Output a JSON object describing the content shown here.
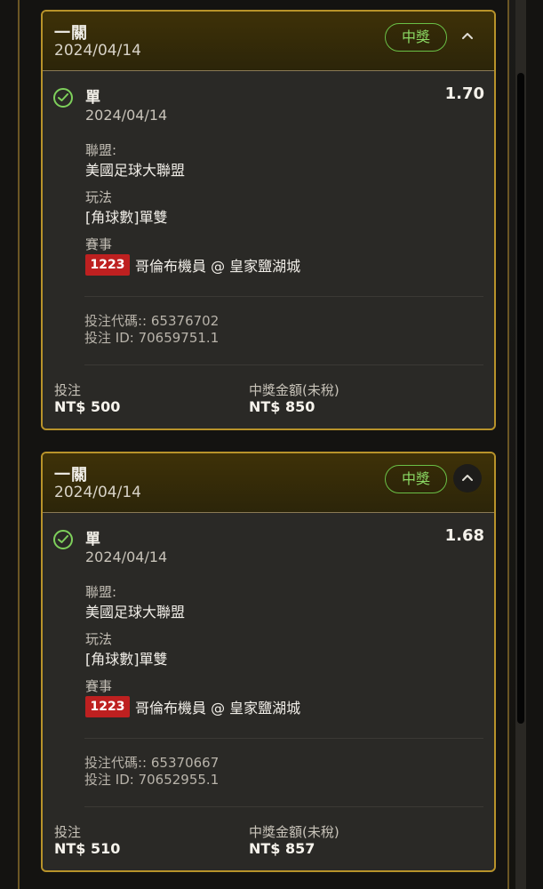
{
  "bets": [
    {
      "title": "一關",
      "header_date": "2024/04/14",
      "status": "中獎",
      "toggle_icon": "chevron-up-icon",
      "selection": {
        "type": "單",
        "date": "2024/04/14",
        "odds": "1.70",
        "league_label": "聯盟:",
        "league": "美國足球大聯盟",
        "play_label": "玩法",
        "play": "[角球數]單雙",
        "match_label": "賽事",
        "event_code": "1223",
        "match": "哥倫布機員 @ 皇家鹽湖城",
        "bet_code_label": "投注代碼::",
        "bet_code": "65376702",
        "bet_id_label": "投注 ID:",
        "bet_id": "70659751.1"
      },
      "stake_label": "投注",
      "stake": "NT$ 500",
      "payout_label": "中獎金額(未稅)",
      "payout": "NT$ 850"
    },
    {
      "title": "一關",
      "header_date": "2024/04/14",
      "status": "中獎",
      "toggle_icon": "chevron-up-icon",
      "selection": {
        "type": "單",
        "date": "2024/04/14",
        "odds": "1.68",
        "league_label": "聯盟:",
        "league": "美國足球大聯盟",
        "play_label": "玩法",
        "play": "[角球數]單雙",
        "match_label": "賽事",
        "event_code": "1223",
        "match": "哥倫布機員 @ 皇家鹽湖城",
        "bet_code_label": "投注代碼::",
        "bet_code": "65370667",
        "bet_id_label": "投注 ID:",
        "bet_id": "70652955.1"
      },
      "stake_label": "投注",
      "stake": "NT$ 510",
      "payout_label": "中獎金額(未稅)",
      "payout": "NT$ 857"
    }
  ],
  "colors": {
    "accent_gold": "#b8932a",
    "win_green": "#6ac046",
    "event_red": "#be2020"
  },
  "icons": {
    "check": "check-circle-icon"
  }
}
